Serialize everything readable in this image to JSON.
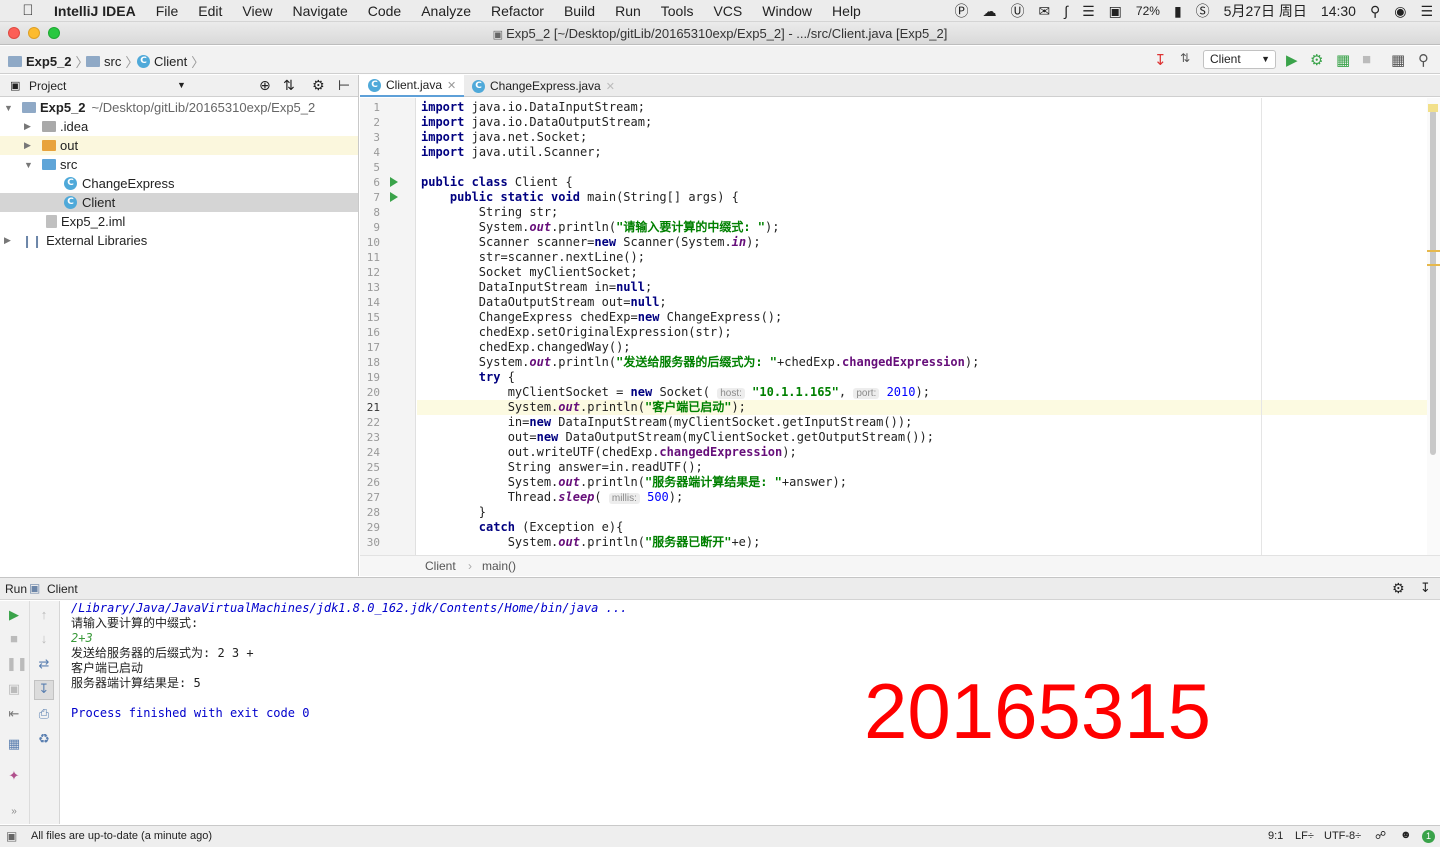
{
  "menubar": {
    "app": "IntelliJ IDEA",
    "items": [
      "File",
      "Edit",
      "View",
      "Navigate",
      "Code",
      "Analyze",
      "Refactor",
      "Build",
      "Run",
      "Tools",
      "VCS",
      "Window",
      "Help"
    ],
    "battery": "72%",
    "date": "5月27日 周日",
    "time": "14:30"
  },
  "window": {
    "title": "Exp5_2 [~/Desktop/gitLib/20165310exp/Exp5_2] - .../src/Client.java [Exp5_2]"
  },
  "navbar": {
    "crumbs": [
      "Exp5_2",
      "src",
      "Client"
    ],
    "run_config": "Client"
  },
  "project": {
    "header": "Project",
    "tree": [
      {
        "label": "Exp5_2",
        "path": "~/Desktop/gitLib/20165310exp/Exp5_2"
      },
      {
        "label": ".idea"
      },
      {
        "label": "out"
      },
      {
        "label": "src"
      },
      {
        "label": "ChangeExpress"
      },
      {
        "label": "Client"
      },
      {
        "label": "Exp5_2.iml"
      },
      {
        "label": "External Libraries"
      }
    ]
  },
  "tabs": [
    {
      "label": "Client.java"
    },
    {
      "label": "ChangeExpress.java"
    }
  ],
  "code": {
    "line_numbers": [
      "1",
      "2",
      "3",
      "4",
      "5",
      "6",
      "7",
      "8",
      "9",
      "10",
      "11",
      "12",
      "13",
      "14",
      "15",
      "16",
      "17",
      "18",
      "19",
      "20",
      "21",
      "22",
      "23",
      "24",
      "25",
      "26",
      "27",
      "28",
      "29",
      "30"
    ],
    "l1": "java.io.DataInputStream;",
    "l2": "java.io.DataOutputStream;",
    "l3": "java.net.Socket;",
    "l4": "java.util.Scanner;",
    "import_kw": "import",
    "l6_a": "public class",
    "l6_b": " Client {",
    "l7_a": "public static void",
    "l7_b": " main(String[] args) {",
    "l8": "String str;",
    "sys": "System.",
    "out": "out",
    "println": ".println(",
    "l9_s": "\"请输入要计算的中缀式: \"",
    "l9_e": ");",
    "l10_a": "Scanner scanner=",
    "new": "new",
    "l10_b": " Scanner(System.",
    "in": "in",
    "l10_c": ");",
    "l11": "str=scanner.nextLine();",
    "l12": "Socket myClientSocket;",
    "l13_a": "DataInputStream in=",
    "null": "null",
    "semi": ";",
    "l14_a": "DataOutputStream out=",
    "l15_a": "ChangeExpress chedExp=",
    "l15_b": " ChangeExpress();",
    "l16": "chedExp.setOriginalExpression(str);",
    "l17": "chedExp.changedWay();",
    "l18_s": "\"发送给服务器的后缀式为: \"",
    "l18_b": "+chedExp.",
    "changedExpression": "changedExpression",
    "l19": "try",
    "l19_b": " {",
    "l20_a": "myClientSocket = ",
    "l20_b": " Socket( ",
    "hint_host": "host:",
    "l20_s": "\"10.1.1.165\"",
    "l20_c": ", ",
    "hint_port": "port:",
    "l20_n": "2010",
    "l20_d": ");",
    "l21_s": "\"客户端已启动\"",
    "l22_a": "in=",
    "l22_b": " DataInputStream(myClientSocket.getInputStream());",
    "l23_a": "out=",
    "l23_b": " DataOutputStream(myClientSocket.getOutputStream());",
    "l24_a": "out.writeUTF(chedExp.",
    "l24_b": ");",
    "l25": "String answer=in.readUTF();",
    "l26_s": "\"服务器端计算结果是: \"",
    "l26_b": "+answer);",
    "l27_a": "Thread.",
    "sleep": "sleep",
    "l27_b": "( ",
    "hint_millis": "millis:",
    "l27_n": "500",
    "l27_c": ");",
    "l28": "}",
    "catch": "catch",
    "l29_b": " (Exception e){",
    "l30_s": "\"服务器已断开\"",
    "l30_b": "+e);"
  },
  "breadcrumb": {
    "cls": "Client",
    "method": "main()"
  },
  "run": {
    "label": "Run",
    "config": "Client",
    "console": [
      "/Library/Java/JavaVirtualMachines/jdk1.8.0_162.jdk/Contents/Home/bin/java ...",
      "请输入要计算的中缀式:",
      "2+3",
      "发送给服务器的后缀式为: 2 3 +",
      "客户端已启动",
      "服务器端计算结果是: 5",
      "",
      "Process finished with exit code 0"
    ],
    "overlay": "20165315"
  },
  "status": {
    "message": "All files are up-to-date (a minute ago)",
    "position": "9:1",
    "line_sep": "LF÷",
    "encoding": "UTF-8÷",
    "badge": "1"
  },
  "colors": {
    "accent": "#3aa34a",
    "overlay": "#ff0000",
    "keyword": "#000080",
    "string": "#008000"
  }
}
